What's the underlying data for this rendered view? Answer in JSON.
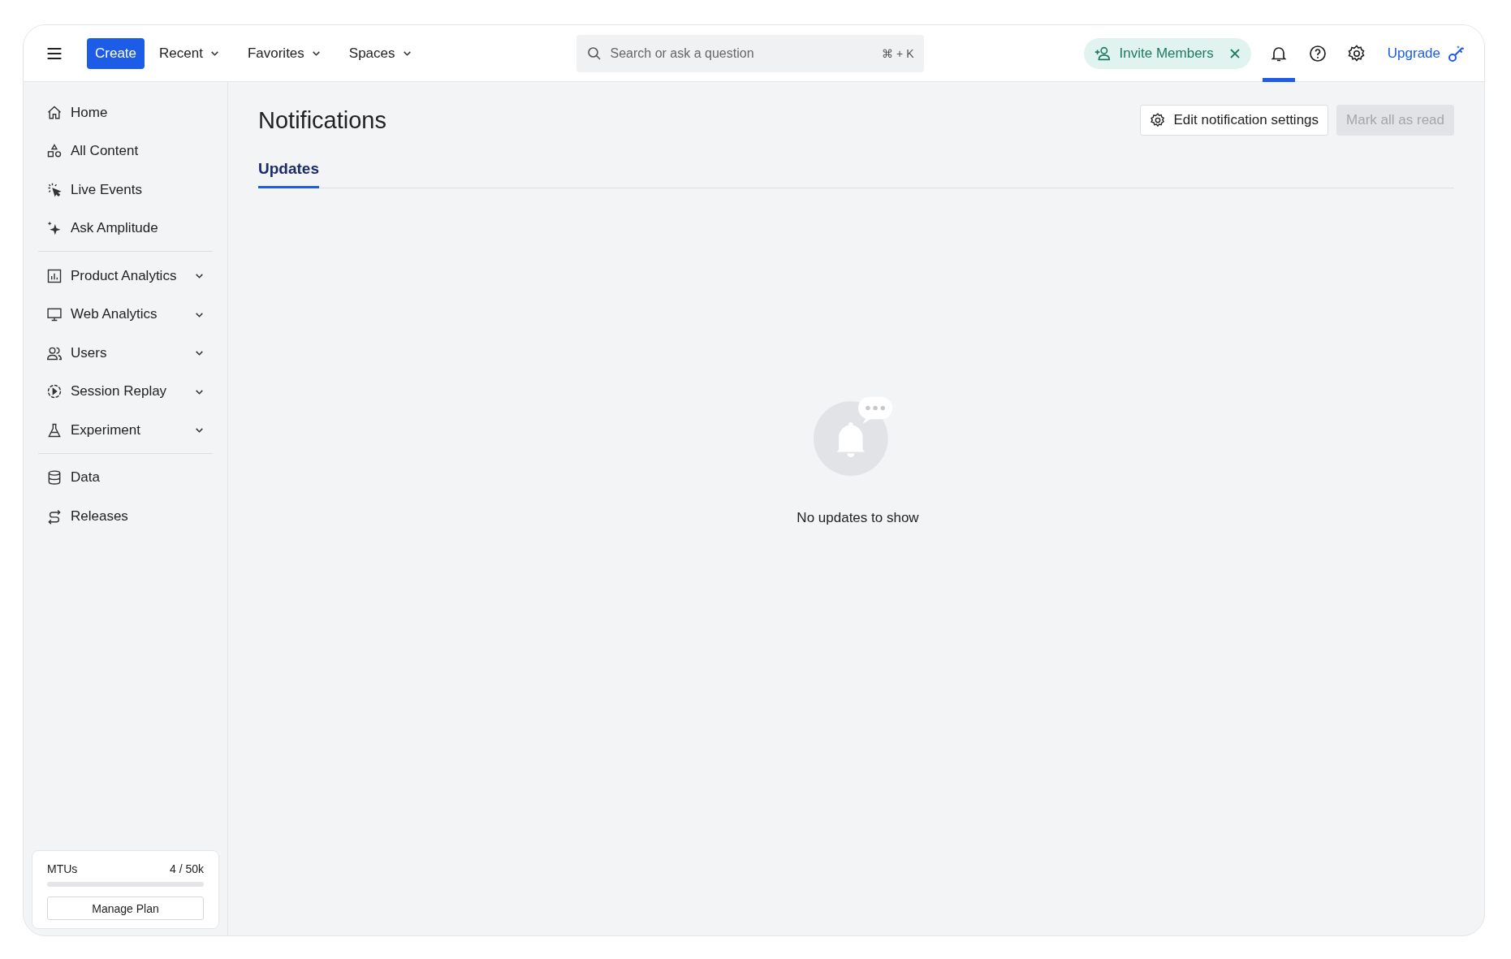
{
  "topbar": {
    "create_label": "Create",
    "menus": [
      {
        "label": "Recent"
      },
      {
        "label": "Favorites"
      },
      {
        "label": "Spaces"
      }
    ],
    "search": {
      "placeholder": "Search or ask a question",
      "shortcut": "⌘ + K"
    },
    "invite": {
      "label": "Invite Members"
    },
    "icon_buttons": [
      {
        "kind": "bell",
        "selected": true
      },
      {
        "kind": "help",
        "selected": false
      },
      {
        "kind": "settings",
        "selected": false
      }
    ],
    "upgrade": {
      "label": "Upgrade"
    }
  },
  "sidebar": {
    "groups": [
      [
        {
          "label": "Home",
          "kind": "home",
          "expandable": false
        },
        {
          "label": "All Content",
          "kind": "shapes",
          "expandable": false
        },
        {
          "label": "Live Events",
          "kind": "cursor",
          "expandable": false
        },
        {
          "label": "Ask Amplitude",
          "kind": "sparkle",
          "expandable": false
        }
      ],
      [
        {
          "label": "Product Analytics",
          "kind": "chart",
          "expandable": true
        },
        {
          "label": "Web Analytics",
          "kind": "monitor",
          "expandable": true
        },
        {
          "label": "Users",
          "kind": "users",
          "expandable": true
        },
        {
          "label": "Session Replay",
          "kind": "replay",
          "expandable": true
        },
        {
          "label": "Experiment",
          "kind": "flask",
          "expandable": true
        }
      ],
      [
        {
          "label": "Data",
          "kind": "database",
          "expandable": false
        },
        {
          "label": "Releases",
          "kind": "releases",
          "expandable": false
        }
      ]
    ],
    "plan": {
      "label": "MTUs",
      "reading": "4 / 50k",
      "level": 0.0001,
      "button": "Manage Plan"
    }
  },
  "main": {
    "title": "Notifications",
    "actions": [
      {
        "label": "Edit notification settings",
        "kind": "settings",
        "disabled": false
      },
      {
        "label": "Mark all as read",
        "kind": "plain",
        "disabled": true
      }
    ],
    "tabs": [
      {
        "label": "Updates",
        "selected": true
      }
    ],
    "empty_message": "No updates to show"
  }
}
